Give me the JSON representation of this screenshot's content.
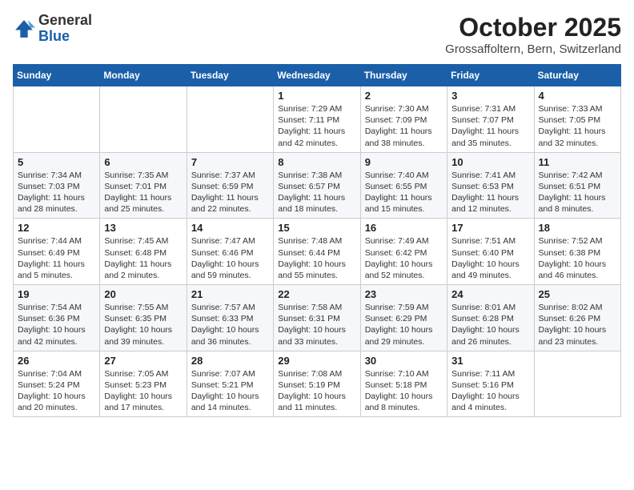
{
  "header": {
    "logo_general": "General",
    "logo_blue": "Blue",
    "month_title": "October 2025",
    "subtitle": "Grossaffoltern, Bern, Switzerland"
  },
  "days_of_week": [
    "Sunday",
    "Monday",
    "Tuesday",
    "Wednesday",
    "Thursday",
    "Friday",
    "Saturday"
  ],
  "weeks": [
    [
      {
        "day": "",
        "info": ""
      },
      {
        "day": "",
        "info": ""
      },
      {
        "day": "",
        "info": ""
      },
      {
        "day": "1",
        "info": "Sunrise: 7:29 AM\nSunset: 7:11 PM\nDaylight: 11 hours and 42 minutes."
      },
      {
        "day": "2",
        "info": "Sunrise: 7:30 AM\nSunset: 7:09 PM\nDaylight: 11 hours and 38 minutes."
      },
      {
        "day": "3",
        "info": "Sunrise: 7:31 AM\nSunset: 7:07 PM\nDaylight: 11 hours and 35 minutes."
      },
      {
        "day": "4",
        "info": "Sunrise: 7:33 AM\nSunset: 7:05 PM\nDaylight: 11 hours and 32 minutes."
      }
    ],
    [
      {
        "day": "5",
        "info": "Sunrise: 7:34 AM\nSunset: 7:03 PM\nDaylight: 11 hours and 28 minutes."
      },
      {
        "day": "6",
        "info": "Sunrise: 7:35 AM\nSunset: 7:01 PM\nDaylight: 11 hours and 25 minutes."
      },
      {
        "day": "7",
        "info": "Sunrise: 7:37 AM\nSunset: 6:59 PM\nDaylight: 11 hours and 22 minutes."
      },
      {
        "day": "8",
        "info": "Sunrise: 7:38 AM\nSunset: 6:57 PM\nDaylight: 11 hours and 18 minutes."
      },
      {
        "day": "9",
        "info": "Sunrise: 7:40 AM\nSunset: 6:55 PM\nDaylight: 11 hours and 15 minutes."
      },
      {
        "day": "10",
        "info": "Sunrise: 7:41 AM\nSunset: 6:53 PM\nDaylight: 11 hours and 12 minutes."
      },
      {
        "day": "11",
        "info": "Sunrise: 7:42 AM\nSunset: 6:51 PM\nDaylight: 11 hours and 8 minutes."
      }
    ],
    [
      {
        "day": "12",
        "info": "Sunrise: 7:44 AM\nSunset: 6:49 PM\nDaylight: 11 hours and 5 minutes."
      },
      {
        "day": "13",
        "info": "Sunrise: 7:45 AM\nSunset: 6:48 PM\nDaylight: 11 hours and 2 minutes."
      },
      {
        "day": "14",
        "info": "Sunrise: 7:47 AM\nSunset: 6:46 PM\nDaylight: 10 hours and 59 minutes."
      },
      {
        "day": "15",
        "info": "Sunrise: 7:48 AM\nSunset: 6:44 PM\nDaylight: 10 hours and 55 minutes."
      },
      {
        "day": "16",
        "info": "Sunrise: 7:49 AM\nSunset: 6:42 PM\nDaylight: 10 hours and 52 minutes."
      },
      {
        "day": "17",
        "info": "Sunrise: 7:51 AM\nSunset: 6:40 PM\nDaylight: 10 hours and 49 minutes."
      },
      {
        "day": "18",
        "info": "Sunrise: 7:52 AM\nSunset: 6:38 PM\nDaylight: 10 hours and 46 minutes."
      }
    ],
    [
      {
        "day": "19",
        "info": "Sunrise: 7:54 AM\nSunset: 6:36 PM\nDaylight: 10 hours and 42 minutes."
      },
      {
        "day": "20",
        "info": "Sunrise: 7:55 AM\nSunset: 6:35 PM\nDaylight: 10 hours and 39 minutes."
      },
      {
        "day": "21",
        "info": "Sunrise: 7:57 AM\nSunset: 6:33 PM\nDaylight: 10 hours and 36 minutes."
      },
      {
        "day": "22",
        "info": "Sunrise: 7:58 AM\nSunset: 6:31 PM\nDaylight: 10 hours and 33 minutes."
      },
      {
        "day": "23",
        "info": "Sunrise: 7:59 AM\nSunset: 6:29 PM\nDaylight: 10 hours and 29 minutes."
      },
      {
        "day": "24",
        "info": "Sunrise: 8:01 AM\nSunset: 6:28 PM\nDaylight: 10 hours and 26 minutes."
      },
      {
        "day": "25",
        "info": "Sunrise: 8:02 AM\nSunset: 6:26 PM\nDaylight: 10 hours and 23 minutes."
      }
    ],
    [
      {
        "day": "26",
        "info": "Sunrise: 7:04 AM\nSunset: 5:24 PM\nDaylight: 10 hours and 20 minutes."
      },
      {
        "day": "27",
        "info": "Sunrise: 7:05 AM\nSunset: 5:23 PM\nDaylight: 10 hours and 17 minutes."
      },
      {
        "day": "28",
        "info": "Sunrise: 7:07 AM\nSunset: 5:21 PM\nDaylight: 10 hours and 14 minutes."
      },
      {
        "day": "29",
        "info": "Sunrise: 7:08 AM\nSunset: 5:19 PM\nDaylight: 10 hours and 11 minutes."
      },
      {
        "day": "30",
        "info": "Sunrise: 7:10 AM\nSunset: 5:18 PM\nDaylight: 10 hours and 8 minutes."
      },
      {
        "day": "31",
        "info": "Sunrise: 7:11 AM\nSunset: 5:16 PM\nDaylight: 10 hours and 4 minutes."
      },
      {
        "day": "",
        "info": ""
      }
    ]
  ]
}
